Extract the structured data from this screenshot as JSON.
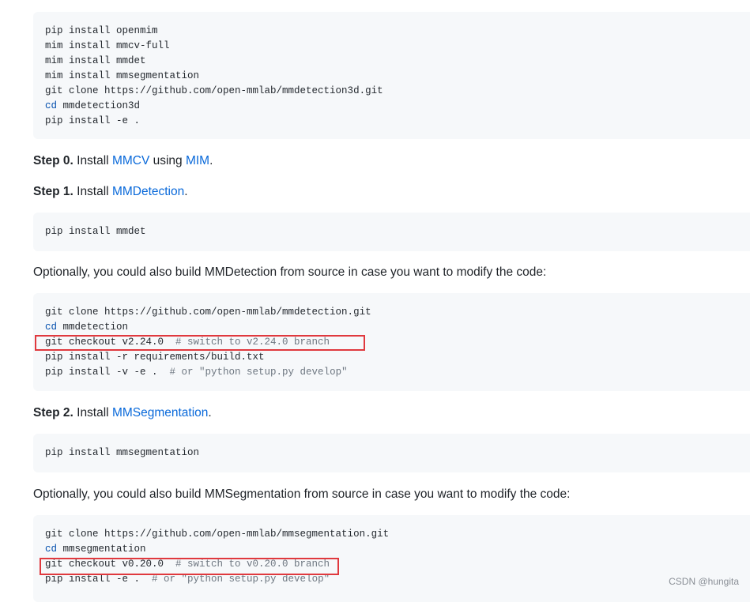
{
  "block0": {
    "lines": [
      [
        "pip install openmim",
        ""
      ],
      [
        "mim install mmcv-full",
        ""
      ],
      [
        "mim install mmdet",
        ""
      ],
      [
        "mim install mmsegmentation",
        ""
      ],
      [
        "git clone https://github.com/open-mmlab/mmdetection3d.git",
        ""
      ],
      [
        "cd",
        " mmdetection3d",
        ""
      ],
      [
        "pip install -e .",
        ""
      ]
    ]
  },
  "step0": {
    "label": "Step 0.",
    "text1": " Install ",
    "link1": "MMCV",
    "text2": " using ",
    "link2": "MIM",
    "text3": "."
  },
  "step1": {
    "label": "Step 1.",
    "text1": " Install ",
    "link1": "MMDetection",
    "text2": "."
  },
  "block1": {
    "line": "pip install mmdet"
  },
  "opt1": {
    "text": "Optionally, you could also build MMDetection from source in case you want to modify the code:"
  },
  "block2": {
    "l1": "git clone https://github.com/open-mmlab/mmdetection.git",
    "l2_kw": "cd",
    "l2_rest": " mmdetection",
    "l3_code": "git checkout v2.24.0  ",
    "l3_comment": "# switch to v2.24.0 branch",
    "l4": "pip install -r requirements/build.txt",
    "l5_code": "pip install -v -e .  ",
    "l5_comment": "# or \"python setup.py develop\""
  },
  "step2": {
    "label": "Step 2.",
    "text1": " Install ",
    "link1": "MMSegmentation",
    "text2": "."
  },
  "block3": {
    "line": "pip install mmsegmentation"
  },
  "opt2": {
    "text": "Optionally, you could also build MMSegmentation from source in case you want to modify the code:"
  },
  "block4": {
    "l1": "git clone https://github.com/open-mmlab/mmsegmentation.git",
    "l2_kw": "cd",
    "l2_rest": " mmsegmentation",
    "l3_code": "git checkout v0.20.0  ",
    "l3_comment": "# switch to v0.20.0 branch",
    "l4_code": "pip install -e .  ",
    "l4_comment": "# or \"python setup.py develop\""
  },
  "watermark": "CSDN @hungita",
  "colors": {
    "link": "#0969da",
    "highlight": "#e0393e",
    "code_bg": "#f6f8fa"
  }
}
